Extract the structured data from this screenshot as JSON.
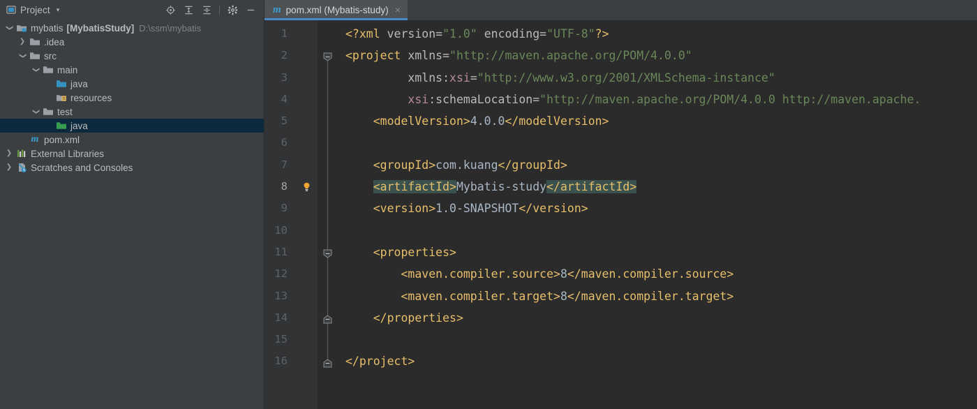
{
  "colors": {
    "sidebar_bg": "#3c3f41",
    "editor_bg": "#2b2b2b",
    "gutter_bg": "#313335",
    "tab_active_bg": "#4e5254",
    "tab_underline": "#4a88c7",
    "selection_bg": "#0d293e",
    "tag_color": "#e8bf6a",
    "attr_value_color": "#6a8759",
    "text_color": "#a9b7c6",
    "match_highlight": "#3b514d",
    "bulb_color": "#f0a732"
  },
  "sidebar": {
    "title": "Project",
    "caret": "▾",
    "panel_icon": "project-panel-icon",
    "tools": [
      {
        "name": "locate-in-tree-icon",
        "label": "Select Opened File"
      },
      {
        "name": "expand-all-icon",
        "label": "Expand All"
      },
      {
        "name": "collapse-all-icon",
        "label": "Collapse All"
      },
      {
        "name": "settings-gear-icon",
        "label": "Options"
      },
      {
        "name": "hide-panel-icon",
        "label": "Hide"
      }
    ],
    "tree": [
      {
        "arrow": "⌄",
        "indent": 0,
        "icon": "module-icon",
        "label": "mybatis",
        "bold": "[MybatisStudy]",
        "path": "D:\\ssm\\mybatis",
        "selected": false
      },
      {
        "arrow": "›",
        "indent": 1,
        "icon": "folder-icon",
        "label": ".idea",
        "bold": "",
        "path": "",
        "selected": false
      },
      {
        "arrow": "⌄",
        "indent": 1,
        "icon": "folder-icon",
        "label": "src",
        "bold": "",
        "path": "",
        "selected": false
      },
      {
        "arrow": "⌄",
        "indent": 2,
        "icon": "folder-icon",
        "label": "main",
        "bold": "",
        "path": "",
        "selected": false
      },
      {
        "arrow": "",
        "indent": 3,
        "icon": "source-root-icon",
        "label": "java",
        "bold": "",
        "path": "",
        "selected": false
      },
      {
        "arrow": "",
        "indent": 3,
        "icon": "resource-root-icon",
        "label": "resources",
        "bold": "",
        "path": "",
        "selected": false
      },
      {
        "arrow": "⌄",
        "indent": 2,
        "icon": "folder-icon",
        "label": "test",
        "bold": "",
        "path": "",
        "selected": false
      },
      {
        "arrow": "",
        "indent": 3,
        "icon": "test-root-icon",
        "label": "java",
        "bold": "",
        "path": "",
        "selected": true
      },
      {
        "arrow": "",
        "indent": 1,
        "icon": "maven-pom-icon",
        "label": "pom.xml",
        "bold": "",
        "path": "",
        "selected": false
      },
      {
        "arrow": "›",
        "indent": 0,
        "icon": "libraries-icon",
        "label": "External Libraries",
        "bold": "",
        "path": "",
        "selected": false
      },
      {
        "arrow": "›",
        "indent": 0,
        "icon": "scratches-icon",
        "label": "Scratches and Consoles",
        "bold": "",
        "path": "",
        "selected": false
      }
    ]
  },
  "editor": {
    "tabs": [
      {
        "icon": "maven-pom-icon",
        "label": "pom.xml (Mybatis-study)",
        "close": "×",
        "active": true
      }
    ],
    "caret_line": 8,
    "gutter_icons": [
      {
        "line": 8,
        "name": "intention-bulb-icon"
      }
    ],
    "fold_markers": [
      {
        "line": 2,
        "type": "open"
      },
      {
        "line": 11,
        "type": "open"
      },
      {
        "line": 14,
        "type": "close"
      },
      {
        "line": 16,
        "type": "close"
      }
    ],
    "line_numbers": [
      1,
      2,
      3,
      4,
      5,
      6,
      7,
      8,
      9,
      10,
      11,
      12,
      13,
      14,
      15,
      16
    ],
    "lines": [
      {
        "n": 1,
        "tokens": [
          {
            "c": "pi",
            "s": "<?xml "
          },
          {
            "c": "an",
            "s": "version="
          },
          {
            "c": "av",
            "s": "\"1.0\""
          },
          {
            "c": "an",
            "s": " encoding="
          },
          {
            "c": "av",
            "s": "\"UTF-8\""
          },
          {
            "c": "pi",
            "s": "?>"
          }
        ]
      },
      {
        "n": 2,
        "tokens": [
          {
            "c": "t",
            "s": "<project "
          },
          {
            "c": "an",
            "s": "xmlns="
          },
          {
            "c": "av",
            "s": "\"http://maven.apache.org/POM/4.0.0\""
          }
        ]
      },
      {
        "n": 3,
        "tokens": [
          {
            "c": "an",
            "s": "         xmlns:"
          },
          {
            "c": "anx",
            "s": "xsi"
          },
          {
            "c": "an",
            "s": "="
          },
          {
            "c": "av",
            "s": "\"http://www.w3.org/2001/XMLSchema-instance\""
          }
        ]
      },
      {
        "n": 4,
        "tokens": [
          {
            "c": "an",
            "s": "         "
          },
          {
            "c": "anx",
            "s": "xsi"
          },
          {
            "c": "an",
            "s": ":schemaLocation="
          },
          {
            "c": "av",
            "s": "\"http://maven.apache.org/POM/4.0.0 http://maven.apache."
          }
        ]
      },
      {
        "n": 5,
        "tokens": [
          {
            "c": "t",
            "s": "    <modelVersion>"
          },
          {
            "c": "txt",
            "s": "4.0.0"
          },
          {
            "c": "t",
            "s": "</modelVersion>"
          }
        ]
      },
      {
        "n": 6,
        "tokens": [
          {
            "c": "txt",
            "s": ""
          }
        ]
      },
      {
        "n": 7,
        "tokens": [
          {
            "c": "t",
            "s": "    <groupId>"
          },
          {
            "c": "txt",
            "s": "com.kuang"
          },
          {
            "c": "t",
            "s": "</groupId>"
          }
        ]
      },
      {
        "n": 8,
        "tokens": [
          {
            "c": "t",
            "s": "    "
          },
          {
            "c": "t hl",
            "s": "<artifactId>"
          },
          {
            "c": "txt",
            "s": "Mybatis-study"
          },
          {
            "c": "t hl",
            "s": "</artifactId>"
          }
        ]
      },
      {
        "n": 9,
        "tokens": [
          {
            "c": "t",
            "s": "    <version>"
          },
          {
            "c": "txt",
            "s": "1.0-SNAPSHOT"
          },
          {
            "c": "t",
            "s": "</version>"
          }
        ]
      },
      {
        "n": 10,
        "tokens": [
          {
            "c": "txt",
            "s": ""
          }
        ]
      },
      {
        "n": 11,
        "tokens": [
          {
            "c": "t",
            "s": "    <properties>"
          }
        ]
      },
      {
        "n": 12,
        "tokens": [
          {
            "c": "t",
            "s": "        <maven.compiler.source>"
          },
          {
            "c": "txt",
            "s": "8"
          },
          {
            "c": "t",
            "s": "</maven.compiler.source>"
          }
        ]
      },
      {
        "n": 13,
        "tokens": [
          {
            "c": "t",
            "s": "        <maven.compiler.target>"
          },
          {
            "c": "txt",
            "s": "8"
          },
          {
            "c": "t",
            "s": "</maven.compiler.target>"
          }
        ]
      },
      {
        "n": 14,
        "tokens": [
          {
            "c": "t",
            "s": "    </properties>"
          }
        ]
      },
      {
        "n": 15,
        "tokens": [
          {
            "c": "txt",
            "s": ""
          }
        ]
      },
      {
        "n": 16,
        "tokens": [
          {
            "c": "t",
            "s": "</project>"
          }
        ]
      }
    ]
  }
}
